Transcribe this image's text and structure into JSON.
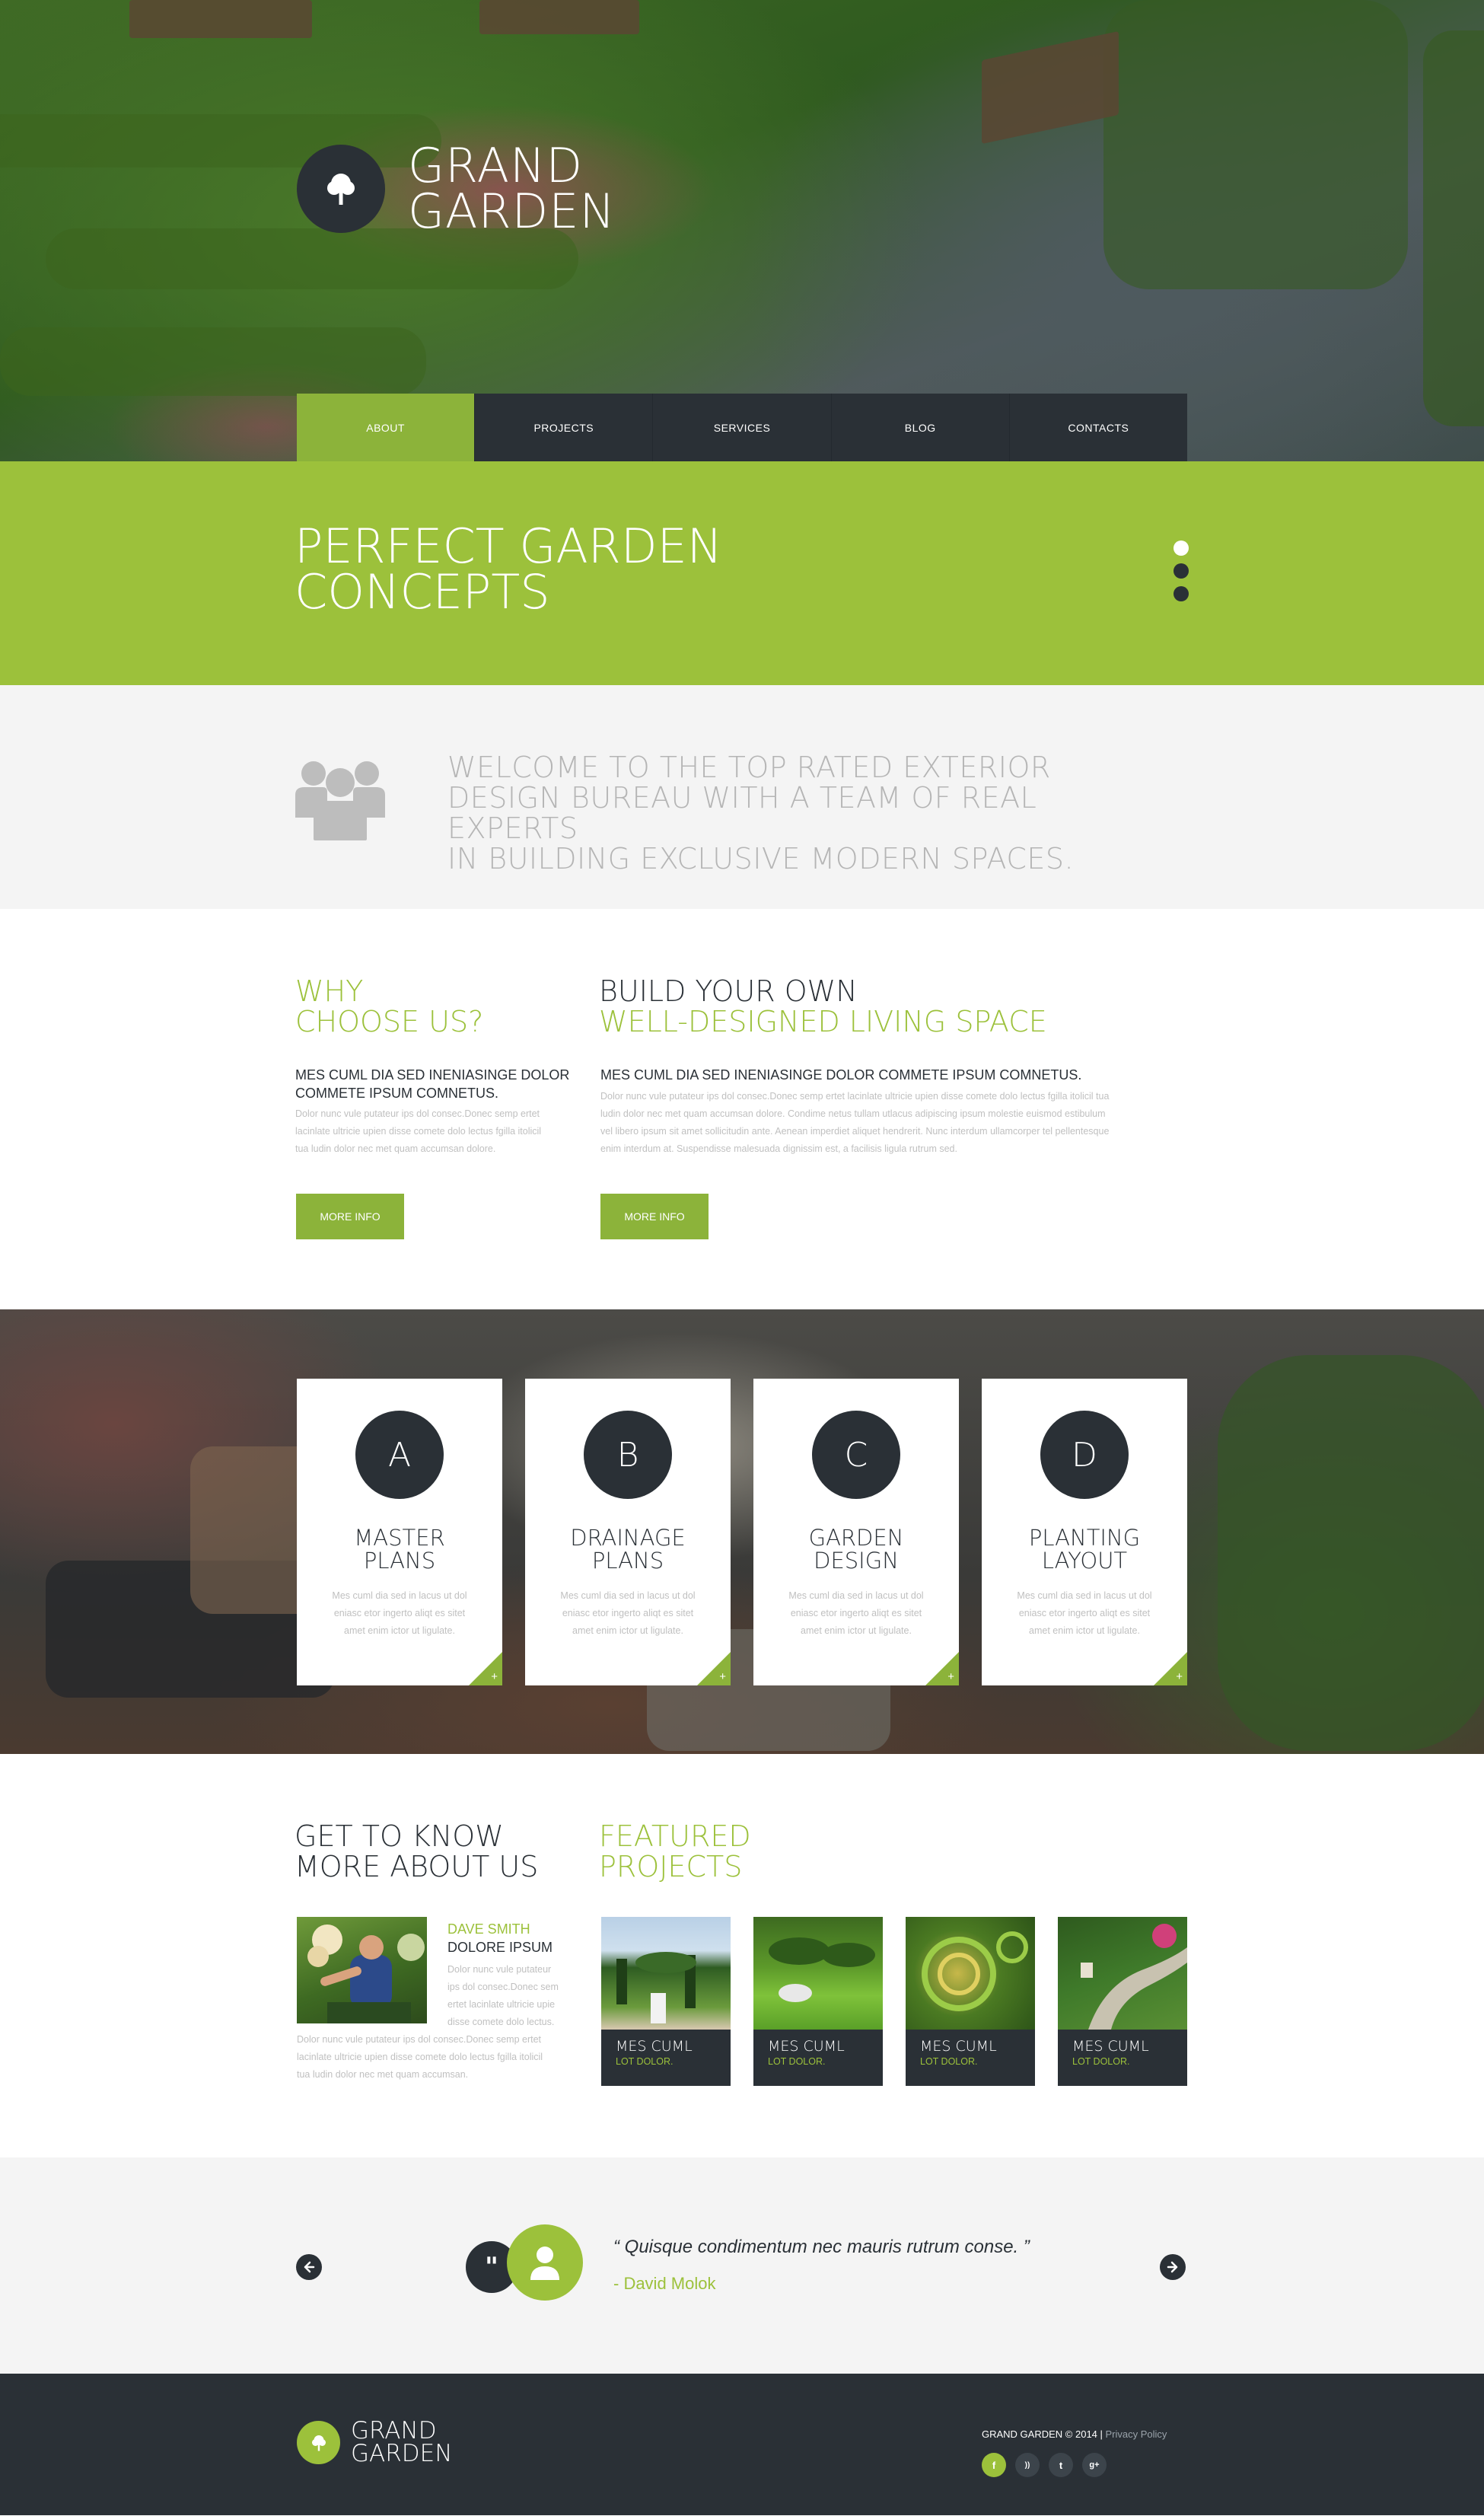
{
  "brand": {
    "line1": "GRAND",
    "line2": "GARDEN"
  },
  "nav": {
    "items": [
      "ABOUT",
      "PROJECTS",
      "SERVICES",
      "BLOG",
      "CONTACTS"
    ],
    "active": "ABOUT"
  },
  "banner": {
    "line1": "PERFECT GARDEN",
    "line2": "CONCEPTS",
    "slides": 3,
    "active_slide": 1
  },
  "welcome": {
    "line1": "WELCOME TO THE TOP RATED EXTERIOR",
    "line2": "DESIGN BUREAU WITH A TEAM OF REAL EXPERTS",
    "line3": "IN BUILDING EXCLUSIVE MODERN SPACES."
  },
  "why": {
    "title1": "WHY",
    "title2": "CHOOSE US?",
    "lead1": "MES CUML DIA SED INENIASINGE DOLOR",
    "lead2": "COMMETE IPSUM COMNETUS.",
    "body1": "Dolor nunc vule putateur ips dol consec.Donec semp ertet",
    "body2": "lacinlate ultricie upien disse comete dolo lectus fgilla itolicil",
    "body3": "tua ludin dolor nec met quam accumsan dolore.",
    "button": "MORE INFO"
  },
  "build": {
    "title1": "BUILD YOUR OWN",
    "title2": "WELL-DESIGNED LIVING SPACE",
    "lead": "MES CUML DIA SED INENIASINGE DOLOR COMMETE IPSUM COMNETUS.",
    "body1": "Dolor nunc vule putateur ips dol consec.Donec semp ertet lacinlate ultricie upien disse comete dolo lectus fgilla itolicil tua",
    "body2": "ludin dolor nec met quam accumsan dolore. Condime netus tullam utlacus adipiscing ipsum molestie euismod estibulum",
    "body3": "vel libero ipsum sit amet sollicitudin ante. Aenean imperdiet aliquet hendrerit. Nunc interdum ullamcorper tel pellentesque",
    "body4": "enim interdum at. Suspendisse malesuada dignissim est, a facilisis ligula rutrum sed.",
    "button": "MORE INFO"
  },
  "services": [
    {
      "letter": "A",
      "line1": "MASTER",
      "line2": "PLANS",
      "text1": "Mes cuml dia sed in lacus ut dol",
      "text2": "eniasc etor ingerto aliqt es sitet",
      "text3": "amet enim ictor ut ligulate.",
      "more": "+"
    },
    {
      "letter": "B",
      "line1": "DRAINAGE",
      "line2": "PLANS",
      "text1": "Mes cuml dia sed in lacus ut dol",
      "text2": "eniasc etor ingerto aliqt es sitet",
      "text3": "amet enim ictor ut ligulate.",
      "more": "+"
    },
    {
      "letter": "C",
      "line1": "GARDEN",
      "line2": "DESIGN",
      "text1": "Mes cuml dia sed in lacus ut dol",
      "text2": "eniasc etor ingerto aliqt es sitet",
      "text3": "amet enim ictor ut ligulate.",
      "more": "+"
    },
    {
      "letter": "D",
      "line1": "PLANTING",
      "line2": "LAYOUT",
      "text1": "Mes cuml dia sed in lacus ut dol",
      "text2": "eniasc etor ingerto aliqt es sitet",
      "text3": "amet enim ictor ut ligulate.",
      "more": "+"
    }
  ],
  "about": {
    "title1": "GET TO KNOW",
    "title2": "MORE ABOUT US",
    "name": "DAVE SMITH",
    "subtitle": "DOLORE IPSUM",
    "side1": "Dolor nunc vule putateur",
    "side2": "ips dol consec.Donec sem",
    "side3": "ertet lacinlate ultricie upie",
    "side4": "disse comete dolo lectus.",
    "body1": "Dolor nunc vule putateur ips dol consec.Donec semp ertet",
    "body2": "lacinlate ultricie upien disse comete dolo lectus fgilla itolicil",
    "body3": "tua ludin dolor nec met quam accumsan."
  },
  "featured": {
    "title1": "FEATURED",
    "title2": "PROJECTS",
    "items": [
      {
        "title": "MES CUML",
        "sub": "LOT DOLOR."
      },
      {
        "title": "MES CUML",
        "sub": "LOT DOLOR."
      },
      {
        "title": "MES CUML",
        "sub": "LOT DOLOR."
      },
      {
        "title": "MES CUML",
        "sub": "LOT DOLOR."
      }
    ]
  },
  "testimonial": {
    "quote": "“ Quisque condimentum nec mauris rutrum conse. ”",
    "author": "- David Molok",
    "quote_mark": "\""
  },
  "footer": {
    "brand1": "GRAND",
    "brand2": "GARDEN",
    "copyright": "GRAND GARDEN © 2014 |",
    "privacy": "Privacy Policy",
    "social": [
      {
        "icon": "facebook-icon",
        "glyph": "f"
      },
      {
        "icon": "rss-icon",
        "glyph": "))"
      },
      {
        "icon": "twitter-icon",
        "glyph": "t"
      },
      {
        "icon": "google-plus-icon",
        "glyph": "g+"
      }
    ]
  },
  "colors": {
    "accent": "#9cc13b",
    "accent_dark": "#8cb33a",
    "dark": "#2a3036",
    "muted_text": "#b5b5b5",
    "light_bg": "#f4f4f4"
  }
}
